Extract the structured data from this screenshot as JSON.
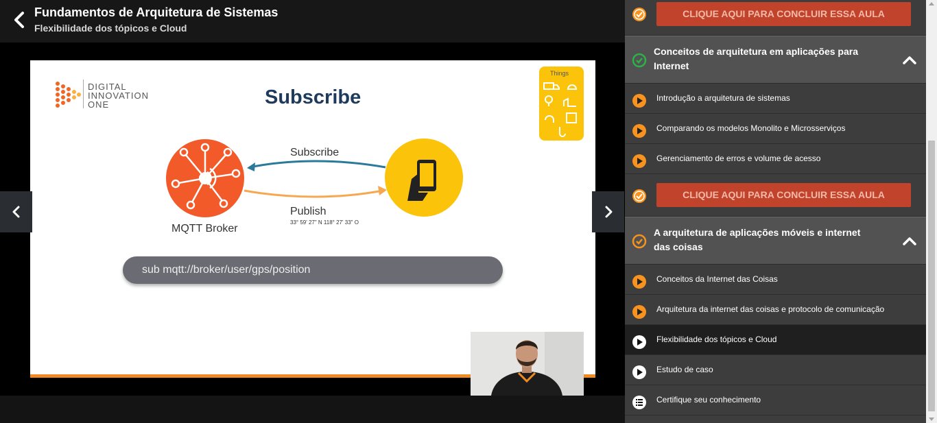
{
  "header": {
    "course_title": "Fundamentos de Arquitetura de Sistemas",
    "lesson_subtitle": "Flexibilidade dos tópicos e Cloud"
  },
  "slide": {
    "brand_line1": "DIGITAL",
    "brand_line2": "INNOVATION",
    "brand_line3": "ONE",
    "title": "Subscribe",
    "subscribe_label": "Subscribe",
    "publish_label": "Publish",
    "coords": "33° 59' 27\" N 118° 27' 33\" O",
    "broker_label": "MQTT Broker",
    "command": "sub mqtt://broker/user/gps/position",
    "things_label": "Things"
  },
  "sidebar": {
    "complete_label": "CLIQUE AQUI PARA CONCLUIR ESSA AULA",
    "modules": [
      {
        "title": "Conceitos de arquitetura em aplicações para Internet",
        "status": "completed",
        "items": [
          {
            "label": "Introdução a arquitetura de sistemas"
          },
          {
            "label": "Comparando os modelos Monolito e Microsserviços"
          },
          {
            "label": "Gerenciamento de erros e volume de acesso"
          }
        ]
      },
      {
        "title": "A arquitetura de aplicações móveis e internet das coisas",
        "status": "in-progress",
        "items": [
          {
            "label": "Conceitos da Internet das Coisas"
          },
          {
            "label": "Arquitetura da internet das coisas e protocolo de comunicação"
          },
          {
            "label": "Flexibilidade dos tópicos e Cloud"
          },
          {
            "label": "Estudo de caso"
          },
          {
            "label": "Certifique seu conhecimento"
          }
        ]
      }
    ]
  },
  "colors": {
    "accent": "#f7931e",
    "complete_button": "#c1432b",
    "completed_check": "#2bb34a",
    "slide_title": "#1e3a5c"
  }
}
